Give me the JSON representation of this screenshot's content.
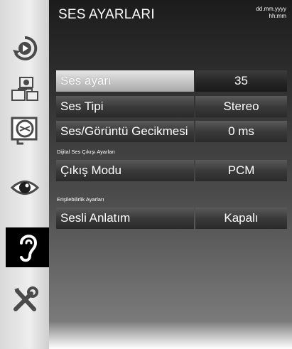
{
  "header": {
    "title": "SES AYARLARI",
    "date": "dd.mm.yyyy",
    "time": "hh:mm"
  },
  "sidebar": {
    "items": [
      {
        "icon": "play-source-icon"
      },
      {
        "icon": "network-icon"
      },
      {
        "icon": "settings-disc-icon"
      },
      {
        "icon": "eye-icon"
      },
      {
        "icon": "ear-icon",
        "selected": true
      },
      {
        "icon": "tools-icon"
      }
    ]
  },
  "settings": {
    "ses_ayari": {
      "label": "Ses ayarı",
      "value": "35"
    },
    "ses_tipi": {
      "label": "Ses Tipi",
      "value": "Stereo"
    },
    "gecikme": {
      "label": "Ses/Görüntü Gecikmesi",
      "value": "0 ms"
    }
  },
  "digital_section": {
    "title": "Dijital Ses Çıkışı Ayarları",
    "cikis_modu": {
      "label": "Çıkış Modu",
      "value": "PCM"
    }
  },
  "accessibility_section": {
    "title": "Erişilebilirlik Ayarları",
    "sesli_anlatim": {
      "label": "Sesli Anlatım",
      "value": "Kapalı"
    }
  },
  "colors": {
    "selected_sidebar": "#000000",
    "text": "#ffffff"
  }
}
